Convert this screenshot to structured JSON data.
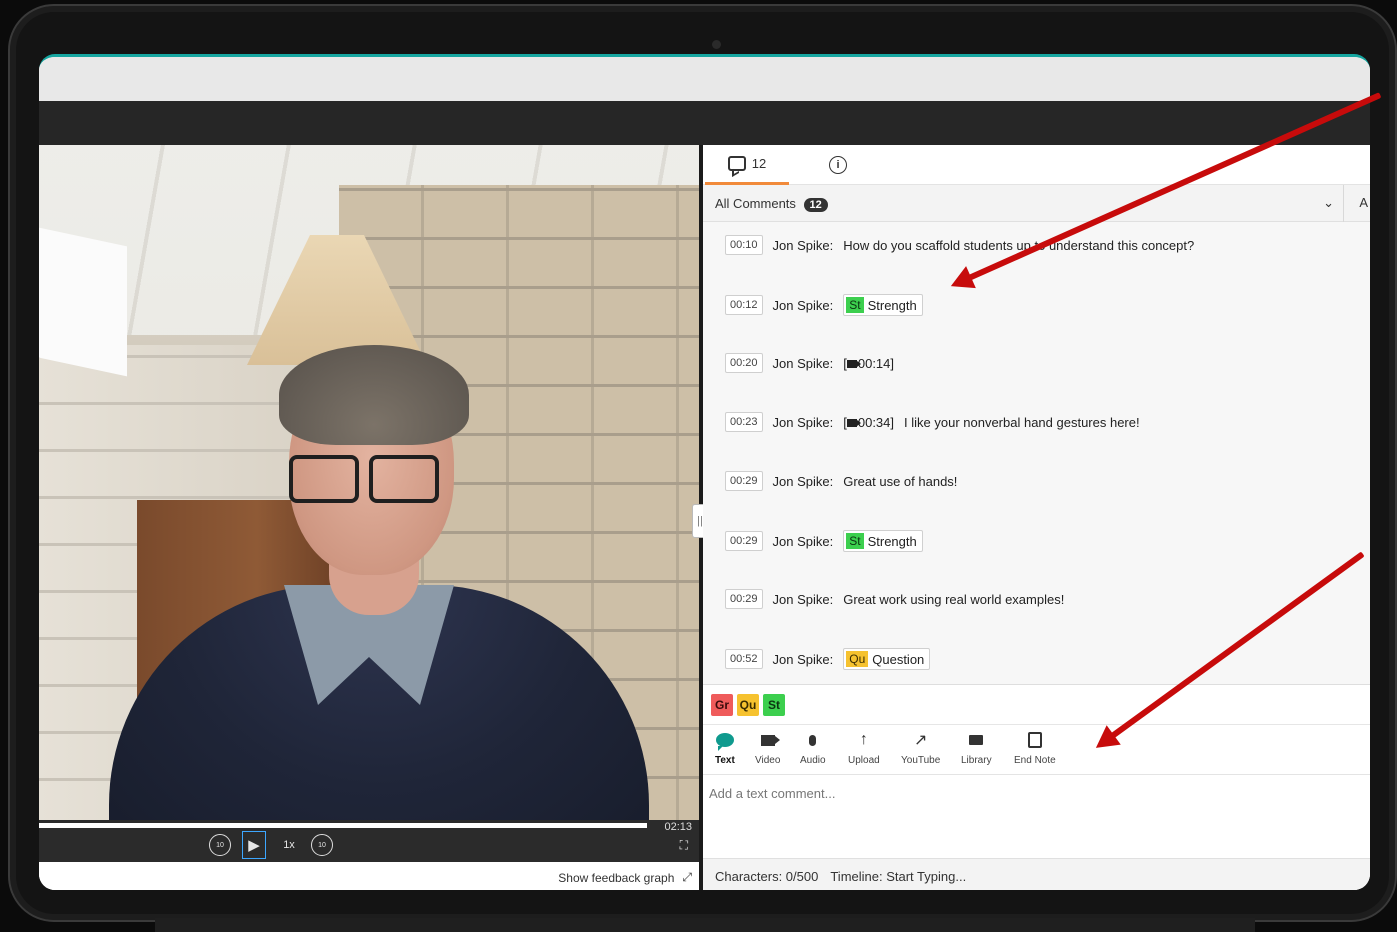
{
  "player": {
    "duration": "02:13",
    "speed": "1x",
    "play_icon": "play-icon",
    "rewind_label": "10",
    "forward_label": "10",
    "progress": 0.0,
    "feedback_link": "Show feedback graph"
  },
  "tabs": {
    "comments_count": "12",
    "comments_icon": "comment-bubble-icon",
    "info_icon": "info-icon"
  },
  "filter": {
    "label": "All Comments",
    "count": "12",
    "extra": "A"
  },
  "comments": [
    {
      "time": "00:10",
      "author": "Jon Spike:",
      "text": "How do you scaffold students up to understand this concept?"
    },
    {
      "time": "00:12",
      "author": "Jon Spike:",
      "tag_code": "St",
      "tag_label": "Strength"
    },
    {
      "time": "00:20",
      "author": "Jon Spike:",
      "media_open": "[",
      "media_time": "00:14]"
    },
    {
      "time": "00:23",
      "author": "Jon Spike:",
      "media_open": "[",
      "media_time": "00:34]",
      "text": "I like your nonverbal hand gestures here!"
    },
    {
      "time": "00:29",
      "author": "Jon Spike:",
      "text": "Great use of hands!"
    },
    {
      "time": "00:29",
      "author": "Jon Spike:",
      "tag_code": "St",
      "tag_label": "Strength"
    },
    {
      "time": "00:29",
      "author": "Jon Spike:",
      "text": "Great work using real world examples!"
    },
    {
      "time": "00:52",
      "author": "Jon Spike:",
      "tag_code": "Qu",
      "tag_label": "Question"
    }
  ],
  "quick_tags": [
    "Gr",
    "Qu",
    "St"
  ],
  "tools": [
    {
      "label": "Text",
      "icon": "speech-bubble-icon"
    },
    {
      "label": "Video",
      "icon": "video-camera-icon"
    },
    {
      "label": "Audio",
      "icon": "microphone-icon"
    },
    {
      "label": "Upload",
      "icon": "upload-arrow-icon"
    },
    {
      "label": "YouTube",
      "icon": "external-link-icon"
    },
    {
      "label": "Library",
      "icon": "folder-icon"
    },
    {
      "label": "End Note",
      "icon": "note-icon"
    }
  ],
  "composer": {
    "placeholder": "Add a text comment...",
    "characters": "Characters: 0/500",
    "timeline": "Timeline:  Start Typing..."
  },
  "colors": {
    "accent": "#16a6a0",
    "tab_underline": "#f18a3a",
    "tag_st": "#3ccf4e",
    "tag_qu": "#f6c22f",
    "tag_gr": "#ef5b5b",
    "annotation_arrow": "#c70b0b"
  }
}
